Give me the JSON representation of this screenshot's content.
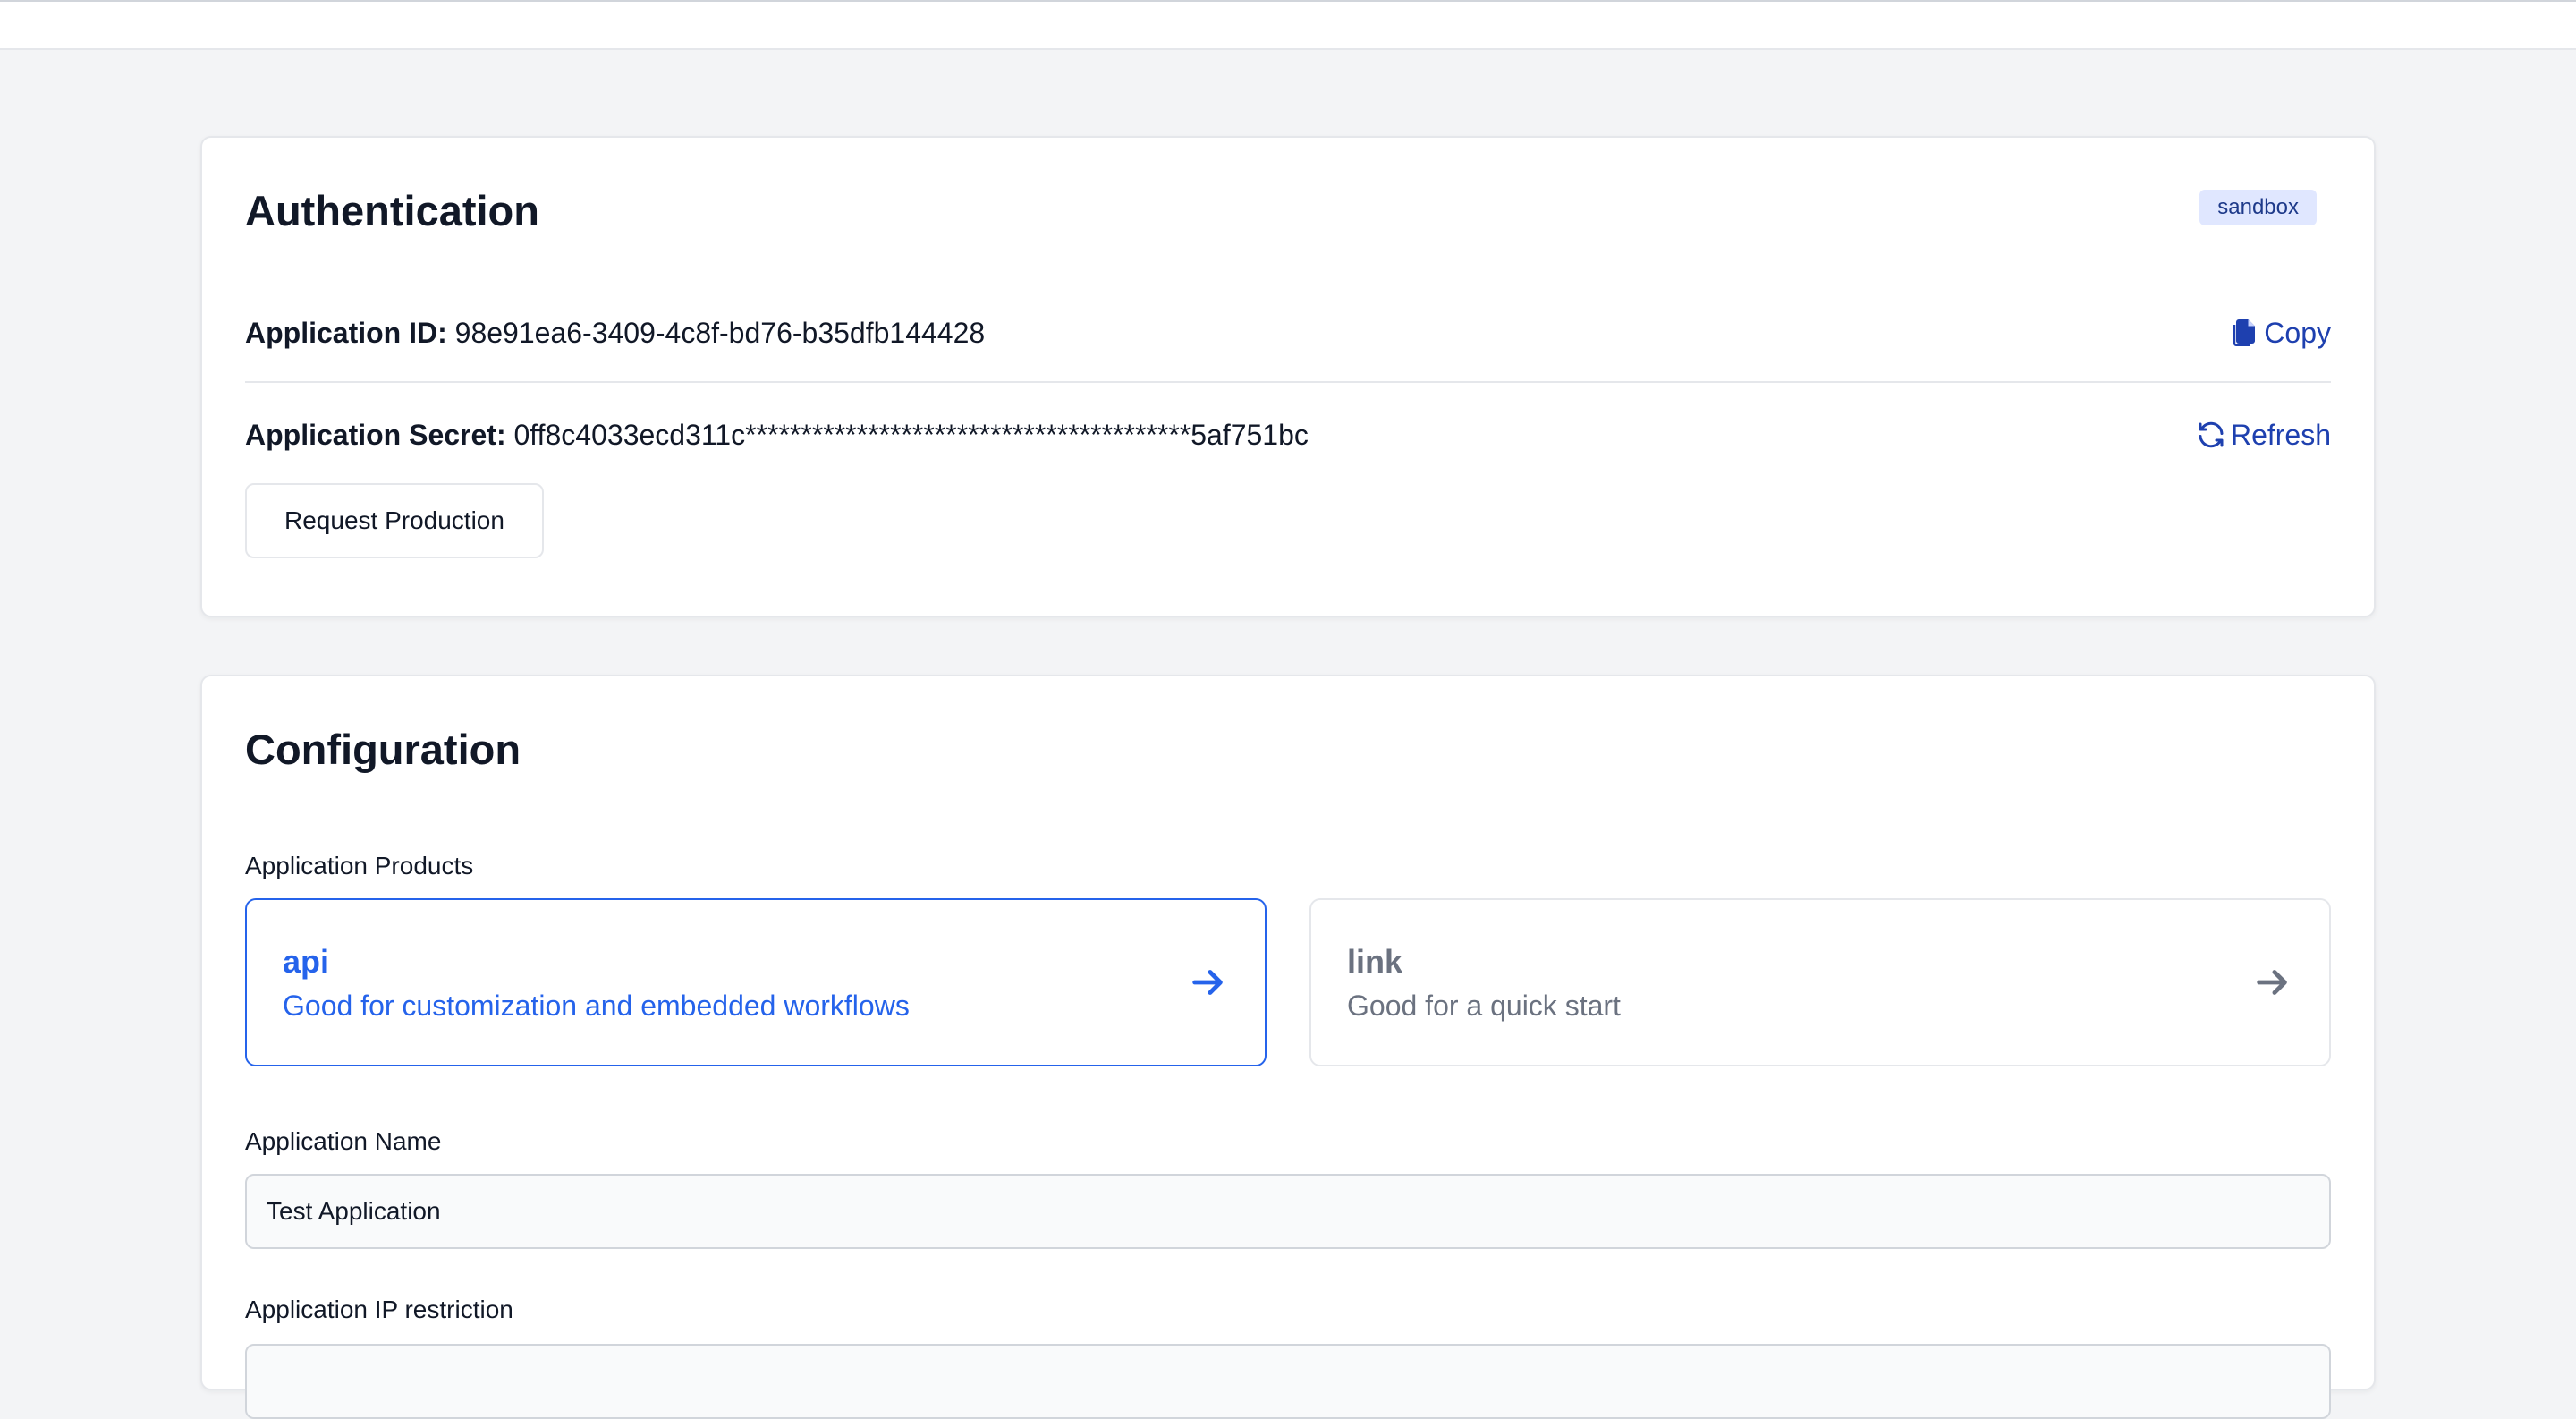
{
  "colors": {
    "accent": "#2563eb",
    "link": "#1e40af",
    "badge_bg": "#e0e7ff"
  },
  "auth": {
    "title": "Authentication",
    "badge": "sandbox",
    "app_id_label": "Application ID:",
    "app_id_value": "98e91ea6-3409-4c8f-bd76-b35dfb144428",
    "copy_label": "Copy",
    "copy_icon": "copy-icon",
    "secret_label": "Application Secret:",
    "secret_value": "0ff8c4033ecd311c****************************************5af751bc",
    "refresh_label": "Refresh",
    "refresh_icon": "refresh-icon",
    "request_button": "Request Production"
  },
  "config": {
    "title": "Configuration",
    "products_label": "Application Products",
    "products": [
      {
        "title": "api",
        "desc": "Good for customization and embedded workflows",
        "selected": true
      },
      {
        "title": "link",
        "desc": "Good for a quick start",
        "selected": false
      }
    ],
    "name_label": "Application Name",
    "name_value": "Test Application",
    "ip_label": "Application IP restriction",
    "ip_value": ""
  }
}
